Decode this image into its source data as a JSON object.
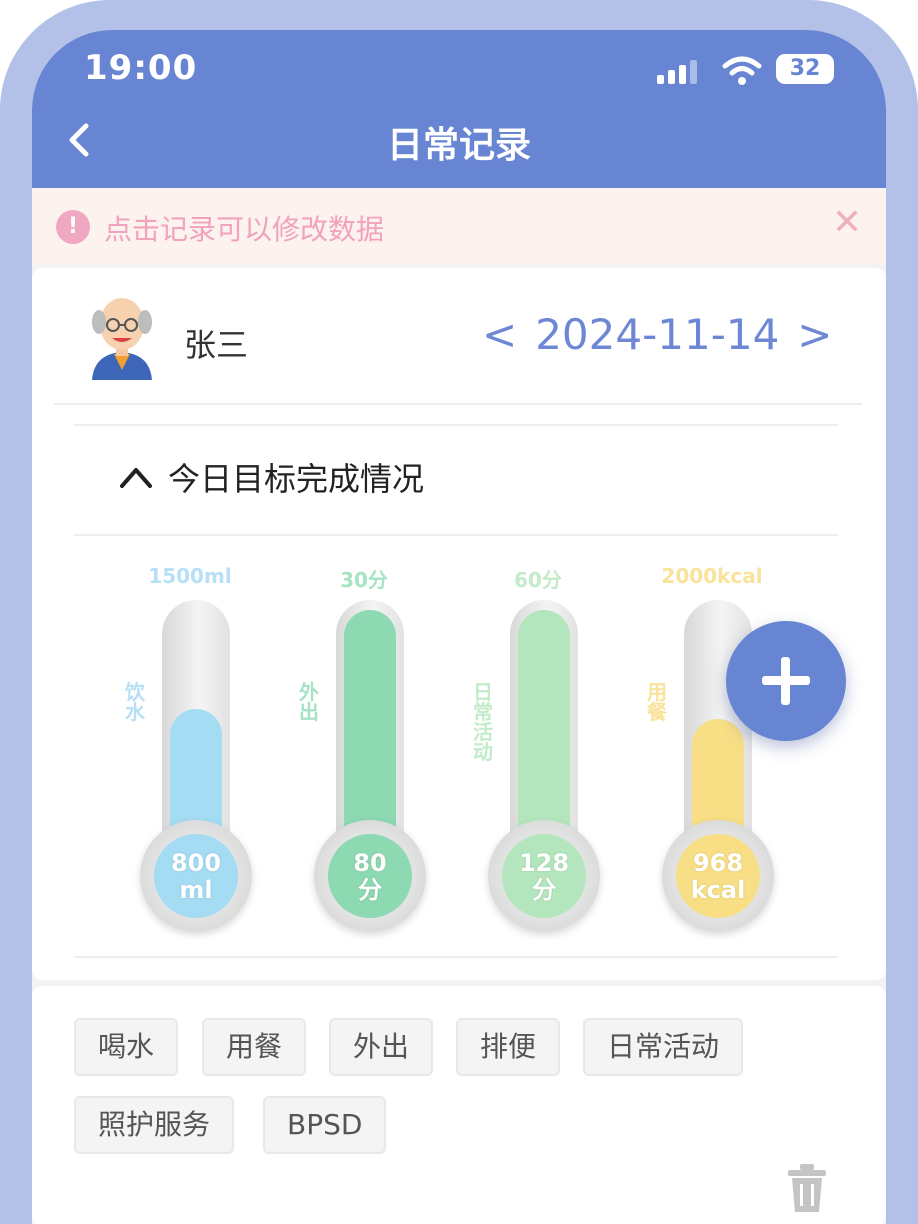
{
  "status_bar": {
    "time": "19:00",
    "battery": "32"
  },
  "nav": {
    "title": "日常记录"
  },
  "notice": {
    "text": "点击记录可以修改数据",
    "icon": "alert-icon"
  },
  "user": {
    "name": "张三"
  },
  "date_nav": {
    "prev": "<",
    "date": "2024-11-14",
    "next": ">"
  },
  "goals": {
    "title": "今日目标完成情况",
    "items": [
      {
        "label": "饮水",
        "target": "1500ml",
        "value": "800",
        "unit": "ml",
        "progress": 0.533,
        "color": "#a4dcf4",
        "text_color": "#b7e0f7"
      },
      {
        "label": "外出",
        "target": "30分",
        "value": "80",
        "unit": "分",
        "progress": 1.0,
        "color": "#8dd9b1",
        "text_color": "#a6e3c3"
      },
      {
        "label": "日常活动",
        "target": "60分",
        "value": "128",
        "unit": "分",
        "progress": 1.0,
        "color": "#b4e6bd",
        "text_color": "#c3ebc9"
      },
      {
        "label": "用餐",
        "target": "2000kcal",
        "value": "968",
        "unit": "kcal",
        "progress": 0.484,
        "color": "#f8df86",
        "text_color": "#f9e39b"
      }
    ]
  },
  "tags": [
    "喝水",
    "用餐",
    "外出",
    "排便",
    "日常活动",
    "照护服务",
    "BPSD"
  ],
  "colors": {
    "primary": "#6785d2",
    "frame": "#b3c1e8",
    "notice_bg": "#fcf2ee",
    "notice_text": "#f2a1bf"
  }
}
